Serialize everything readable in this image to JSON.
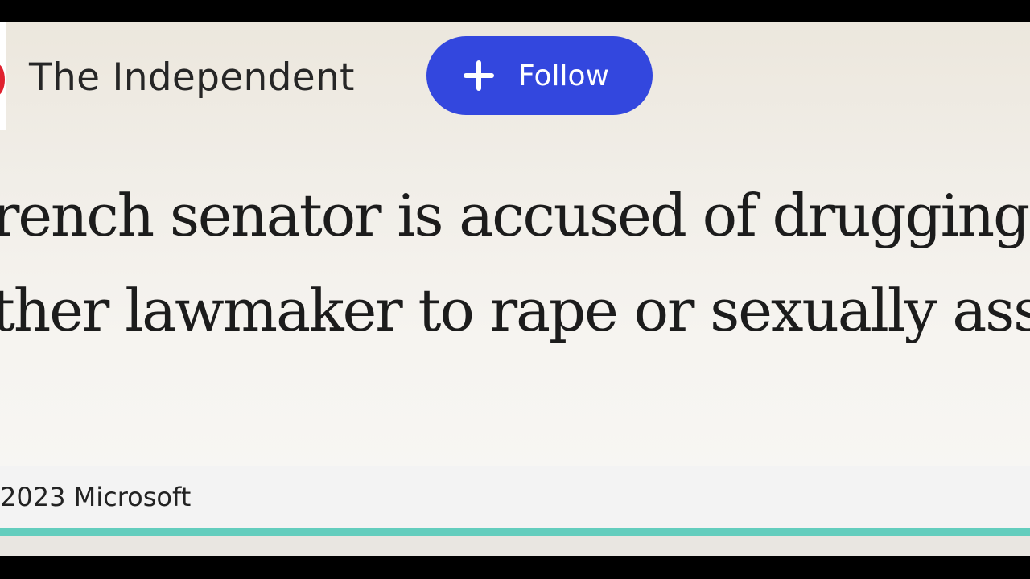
{
  "header": {
    "publisher_name": "The Independent",
    "follow_label": "Follow",
    "follow_icon": "plus-icon"
  },
  "article": {
    "headline_line_1": "rench senator is accused of drugging",
    "headline_line_2": "ther lawmaker to rape or sexually ass"
  },
  "footer": {
    "copyright": "2023 Microsoft"
  },
  "colors": {
    "follow_button": "#3347de",
    "accent_line": "#63cdbd",
    "logo_red": "#e0212e"
  }
}
